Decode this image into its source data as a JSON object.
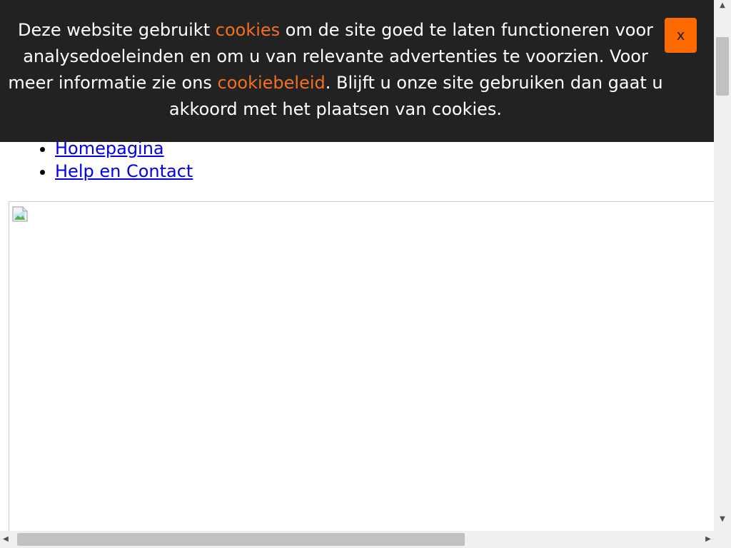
{
  "cookie_banner": {
    "text_1": "Deze website gebruikt ",
    "link_cookies": "cookies",
    "text_2": " om de site goed te laten functioneren voor analysedoeleinden en om u van relevante advertenties te voorzien. Voor meer informatie zie ons ",
    "link_policy": "cookiebeleid",
    "text_3": ". Blijft u onze site gebruiken dan gaat u akkoord met het plaatsen van cookies.",
    "close_label": "x",
    "accent_color": "#f36f21",
    "close_bg_color": "#ff6a00",
    "background_color": "#222222"
  },
  "nav": {
    "items": [
      {
        "label": "Homepagina"
      },
      {
        "label": "Help en Contact"
      }
    ]
  },
  "image": {
    "icon": "broken-image-icon"
  },
  "scrollbars": {
    "up_icon": "▲",
    "down_icon": "▼",
    "left_icon": "◀",
    "right_icon": "▶"
  }
}
